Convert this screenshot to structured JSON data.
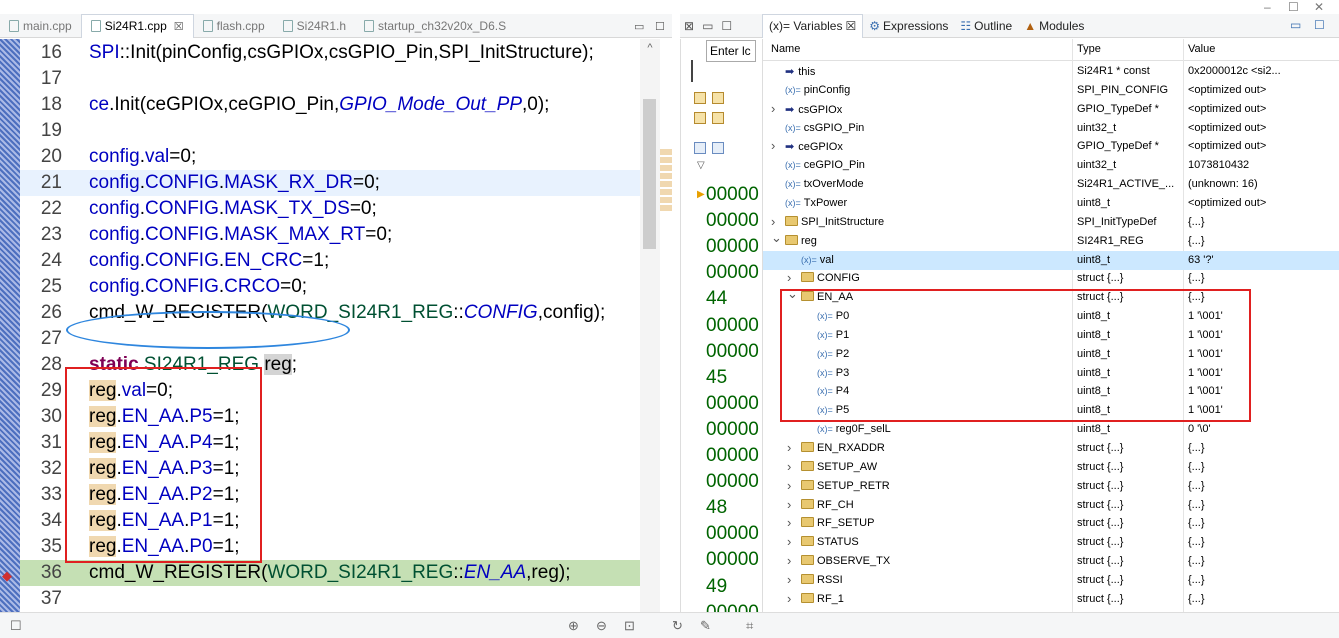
{
  "editor_tabs": [
    {
      "label": "main.cpp",
      "active": false
    },
    {
      "label": "Si24R1.cpp",
      "active": true,
      "close": "☒"
    },
    {
      "label": "flash.cpp",
      "active": false
    },
    {
      "label": "Si24R1.h",
      "active": false
    },
    {
      "label": "startup_ch32v20x_D6.S",
      "active": false
    }
  ],
  "code_lines": [
    {
      "num": "16",
      "segments": [
        {
          "t": "SPI",
          "c": "blue"
        },
        {
          "t": "::Init(pinConfig,csGPIOx,csGPIO_Pin,SPI_InitStructure);",
          "c": ""
        }
      ]
    },
    {
      "num": "17",
      "segments": []
    },
    {
      "num": "18",
      "segments": [
        {
          "t": "ce",
          "c": "blue"
        },
        {
          "t": ".Init(ceGPIOx,ceGPIO_Pin,",
          "c": ""
        },
        {
          "t": "GPIO_Mode_Out_PP",
          "c": "ital"
        },
        {
          "t": ",0);",
          "c": ""
        }
      ]
    },
    {
      "num": "19",
      "segments": []
    },
    {
      "num": "20",
      "segments": [
        {
          "t": "config",
          "c": "blue"
        },
        {
          "t": ".",
          "c": ""
        },
        {
          "t": "val",
          "c": "blue"
        },
        {
          "t": "=0;",
          "c": ""
        }
      ]
    },
    {
      "num": "21",
      "segments": [
        {
          "t": "config",
          "c": "blue"
        },
        {
          "t": ".",
          "c": ""
        },
        {
          "t": "CONFIG",
          "c": "blue"
        },
        {
          "t": ".",
          "c": ""
        },
        {
          "t": "MASK_RX_DR",
          "c": "blue"
        },
        {
          "t": "=0;",
          "c": ""
        }
      ],
      "hl": true
    },
    {
      "num": "22",
      "segments": [
        {
          "t": "config",
          "c": "blue"
        },
        {
          "t": ".",
          "c": ""
        },
        {
          "t": "CONFIG",
          "c": "blue"
        },
        {
          "t": ".",
          "c": ""
        },
        {
          "t": "MASK_TX_DS",
          "c": "blue"
        },
        {
          "t": "=0;",
          "c": ""
        }
      ]
    },
    {
      "num": "23",
      "segments": [
        {
          "t": "config",
          "c": "blue"
        },
        {
          "t": ".",
          "c": ""
        },
        {
          "t": "CONFIG",
          "c": "blue"
        },
        {
          "t": ".",
          "c": ""
        },
        {
          "t": "MASK_MAX_RT",
          "c": "blue"
        },
        {
          "t": "=0;",
          "c": ""
        }
      ]
    },
    {
      "num": "24",
      "segments": [
        {
          "t": "config",
          "c": "blue"
        },
        {
          "t": ".",
          "c": ""
        },
        {
          "t": "CONFIG",
          "c": "blue"
        },
        {
          "t": ".",
          "c": ""
        },
        {
          "t": "EN_CRC",
          "c": "blue"
        },
        {
          "t": "=1;",
          "c": ""
        }
      ]
    },
    {
      "num": "25",
      "segments": [
        {
          "t": "config",
          "c": "blue"
        },
        {
          "t": ".",
          "c": ""
        },
        {
          "t": "CONFIG",
          "c": "blue"
        },
        {
          "t": ".",
          "c": ""
        },
        {
          "t": "CRCO",
          "c": "blue"
        },
        {
          "t": "=0;",
          "c": ""
        }
      ]
    },
    {
      "num": "26",
      "segments": [
        {
          "t": "cmd_W_REGISTER(",
          "c": ""
        },
        {
          "t": "WORD_SI24R1_REG",
          "c": "teal"
        },
        {
          "t": "::",
          "c": ""
        },
        {
          "t": "CONFIG",
          "c": "ital"
        },
        {
          "t": ",config);",
          "c": ""
        }
      ]
    },
    {
      "num": "27",
      "segments": []
    },
    {
      "num": "28",
      "segments": [
        {
          "t": "static",
          "c": "kw"
        },
        {
          "t": " ",
          "c": ""
        },
        {
          "t": "SI24R1_REG",
          "c": "teal"
        },
        {
          "t": " ",
          "c": ""
        },
        {
          "t": "reg",
          "c": "grey-hl"
        },
        {
          "t": ";",
          "c": ""
        }
      ]
    },
    {
      "num": "29",
      "segments": [
        {
          "t": "reg",
          "c": "tan"
        },
        {
          "t": ".",
          "c": ""
        },
        {
          "t": "val",
          "c": "blue"
        },
        {
          "t": "=0;",
          "c": ""
        }
      ]
    },
    {
      "num": "30",
      "segments": [
        {
          "t": "reg",
          "c": "tan"
        },
        {
          "t": ".",
          "c": ""
        },
        {
          "t": "EN_AA",
          "c": "blue"
        },
        {
          "t": ".",
          "c": ""
        },
        {
          "t": "P5",
          "c": "blue"
        },
        {
          "t": "=1;",
          "c": ""
        }
      ]
    },
    {
      "num": "31",
      "segments": [
        {
          "t": "reg",
          "c": "tan"
        },
        {
          "t": ".",
          "c": ""
        },
        {
          "t": "EN_AA",
          "c": "blue"
        },
        {
          "t": ".",
          "c": ""
        },
        {
          "t": "P4",
          "c": "blue"
        },
        {
          "t": "=1;",
          "c": ""
        }
      ]
    },
    {
      "num": "32",
      "segments": [
        {
          "t": "reg",
          "c": "tan"
        },
        {
          "t": ".",
          "c": ""
        },
        {
          "t": "EN_AA",
          "c": "blue"
        },
        {
          "t": ".",
          "c": ""
        },
        {
          "t": "P3",
          "c": "blue"
        },
        {
          "t": "=1;",
          "c": ""
        }
      ]
    },
    {
      "num": "33",
      "segments": [
        {
          "t": "reg",
          "c": "tan"
        },
        {
          "t": ".",
          "c": ""
        },
        {
          "t": "EN_AA",
          "c": "blue"
        },
        {
          "t": ".",
          "c": ""
        },
        {
          "t": "P2",
          "c": "blue"
        },
        {
          "t": "=1;",
          "c": ""
        }
      ]
    },
    {
      "num": "34",
      "segments": [
        {
          "t": "reg",
          "c": "tan"
        },
        {
          "t": ".",
          "c": ""
        },
        {
          "t": "EN_AA",
          "c": "blue"
        },
        {
          "t": ".",
          "c": ""
        },
        {
          "t": "P1",
          "c": "blue"
        },
        {
          "t": "=1;",
          "c": ""
        }
      ]
    },
    {
      "num": "35",
      "segments": [
        {
          "t": "reg",
          "c": "tan"
        },
        {
          "t": ".",
          "c": ""
        },
        {
          "t": "EN_AA",
          "c": "blue"
        },
        {
          "t": ".",
          "c": ""
        },
        {
          "t": "P0",
          "c": "blue"
        },
        {
          "t": "=1;",
          "c": ""
        }
      ]
    },
    {
      "num": "36",
      "segments": [
        {
          "t": "cmd_W_REGISTER(",
          "c": ""
        },
        {
          "t": "WORD_SI24R1_REG",
          "c": "teal"
        },
        {
          "t": "::",
          "c": ""
        },
        {
          "t": "EN_AA",
          "c": "ital"
        },
        {
          "t": ",",
          "c": ""
        },
        {
          "t": "reg",
          "c": ""
        },
        {
          "t": ");",
          "c": ""
        }
      ],
      "cur": true
    },
    {
      "num": "37",
      "segments": []
    }
  ],
  "disassembly": {
    "input_value": "Enter lc",
    "lines": [
      "00000",
      "00000",
      "00000",
      "00000",
      "44",
      "00000",
      "00000",
      "45",
      "00000",
      "00000",
      "00000",
      "00000",
      "48",
      "00000",
      "00000",
      "49",
      "00000"
    ]
  },
  "variables_tabs": [
    {
      "label": "(x)= Variables",
      "close": "☒",
      "active": true
    },
    {
      "label": "Expressions",
      "active": false
    },
    {
      "label": "Outline",
      "active": false
    },
    {
      "label": "Modules",
      "active": false
    }
  ],
  "variables_columns": {
    "name": "Name",
    "type": "Type",
    "value": "Value"
  },
  "variables": [
    {
      "name": "this",
      "type": "Si24R1 * const",
      "value": "0x2000012c <si2...",
      "icon": "ptr",
      "indent": 0,
      "expander": ""
    },
    {
      "name": "pinConfig",
      "type": "SPI_PIN_CONFIG",
      "value": "<optimized out>",
      "icon": "x",
      "indent": 0,
      "expander": ""
    },
    {
      "name": "csGPIOx",
      "type": "GPIO_TypeDef *",
      "value": "<optimized out>",
      "icon": "ptr",
      "indent": 0,
      "expander": ">"
    },
    {
      "name": "csGPIO_Pin",
      "type": "uint32_t",
      "value": "<optimized out>",
      "icon": "x",
      "indent": 0,
      "expander": ""
    },
    {
      "name": "ceGPIOx",
      "type": "GPIO_TypeDef *",
      "value": "<optimized out>",
      "icon": "ptr",
      "indent": 0,
      "expander": ">"
    },
    {
      "name": "ceGPIO_Pin",
      "type": "uint32_t",
      "value": "1073810432",
      "icon": "x",
      "indent": 0,
      "expander": ""
    },
    {
      "name": "txOverMode",
      "type": "Si24R1_ACTIVE_...",
      "value": "(unknown: 16)",
      "icon": "x",
      "indent": 0,
      "expander": ""
    },
    {
      "name": "TxPower",
      "type": "uint8_t",
      "value": "<optimized out>",
      "icon": "x",
      "indent": 0,
      "expander": ""
    },
    {
      "name": "SPI_InitStructure",
      "type": "SPI_InitTypeDef",
      "value": "{...}",
      "icon": "fold",
      "indent": 0,
      "expander": ">"
    },
    {
      "name": "reg",
      "type": "SI24R1_REG",
      "value": "{...}",
      "icon": "fold",
      "indent": 0,
      "expander": "v"
    },
    {
      "name": "val",
      "type": "uint8_t",
      "value": "63 '?'",
      "icon": "x",
      "indent": 1,
      "expander": "",
      "selected": true
    },
    {
      "name": "CONFIG",
      "type": "struct {...}",
      "value": "{...}",
      "icon": "fold",
      "indent": 1,
      "expander": ">"
    },
    {
      "name": "EN_AA",
      "type": "struct {...}",
      "value": "{...}",
      "icon": "fold",
      "indent": 1,
      "expander": "v"
    },
    {
      "name": "P0",
      "type": "uint8_t",
      "value": "1 '\\001'",
      "icon": "x",
      "indent": 2,
      "expander": ""
    },
    {
      "name": "P1",
      "type": "uint8_t",
      "value": "1 '\\001'",
      "icon": "x",
      "indent": 2,
      "expander": ""
    },
    {
      "name": "P2",
      "type": "uint8_t",
      "value": "1 '\\001'",
      "icon": "x",
      "indent": 2,
      "expander": ""
    },
    {
      "name": "P3",
      "type": "uint8_t",
      "value": "1 '\\001'",
      "icon": "x",
      "indent": 2,
      "expander": ""
    },
    {
      "name": "P4",
      "type": "uint8_t",
      "value": "1 '\\001'",
      "icon": "x",
      "indent": 2,
      "expander": ""
    },
    {
      "name": "P5",
      "type": "uint8_t",
      "value": "1 '\\001'",
      "icon": "x",
      "indent": 2,
      "expander": ""
    },
    {
      "name": "reg0F_selL",
      "type": "uint8_t",
      "value": "0 '\\0'",
      "icon": "x",
      "indent": 2,
      "expander": ""
    },
    {
      "name": "EN_RXADDR",
      "type": "struct {...}",
      "value": "{...}",
      "icon": "fold",
      "indent": 1,
      "expander": ">"
    },
    {
      "name": "SETUP_AW",
      "type": "struct {...}",
      "value": "{...}",
      "icon": "fold",
      "indent": 1,
      "expander": ">"
    },
    {
      "name": "SETUP_RETR",
      "type": "struct {...}",
      "value": "{...}",
      "icon": "fold",
      "indent": 1,
      "expander": ">"
    },
    {
      "name": "RF_CH",
      "type": "struct {...}",
      "value": "{...}",
      "icon": "fold",
      "indent": 1,
      "expander": ">"
    },
    {
      "name": "RF_SETUP",
      "type": "struct {...}",
      "value": "{...}",
      "icon": "fold",
      "indent": 1,
      "expander": ">"
    },
    {
      "name": "STATUS",
      "type": "struct {...}",
      "value": "{...}",
      "icon": "fold",
      "indent": 1,
      "expander": ">"
    },
    {
      "name": "OBSERVE_TX",
      "type": "struct {...}",
      "value": "{...}",
      "icon": "fold",
      "indent": 1,
      "expander": ">"
    },
    {
      "name": "RSSI",
      "type": "struct {...}",
      "value": "{...}",
      "icon": "fold",
      "indent": 1,
      "expander": ">"
    },
    {
      "name": "RF_1",
      "type": "struct {...}",
      "value": "{...}",
      "icon": "fold",
      "indent": 1,
      "expander": ">"
    }
  ],
  "colors": {
    "annotation_red": "#e02020",
    "annotation_blue": "#2e86de",
    "current_line": "#c5e0b4",
    "selected_row": "#cce8ff"
  }
}
